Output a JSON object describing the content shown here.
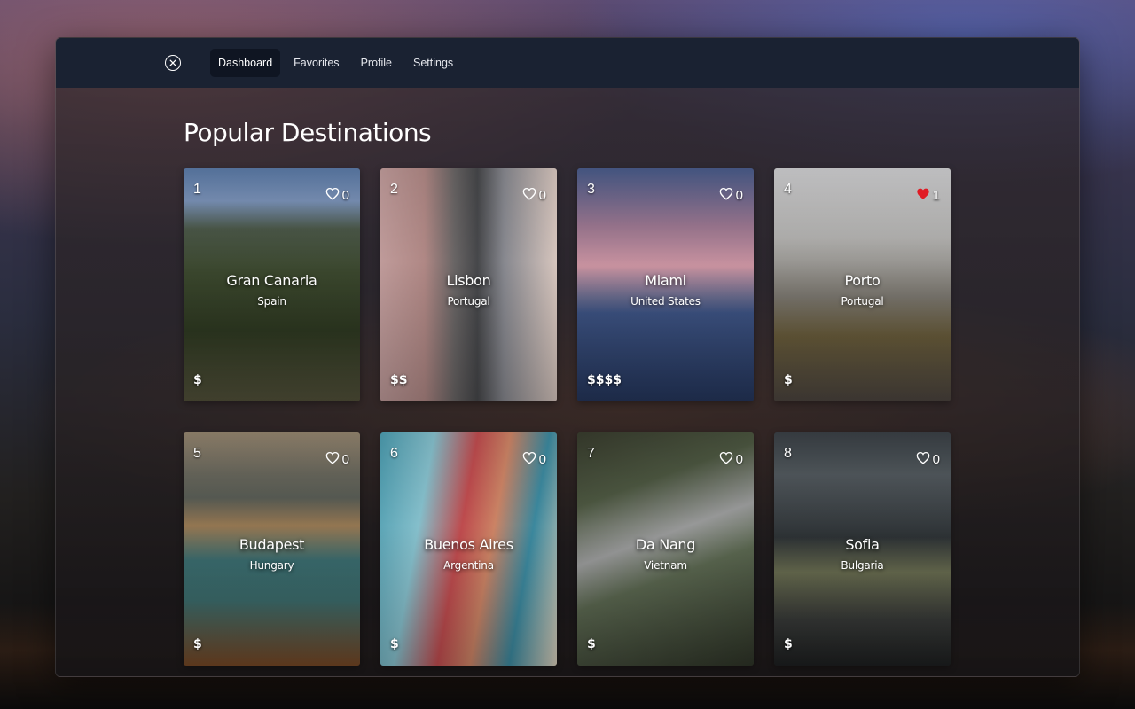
{
  "colors": {
    "topbar": "#1a2232",
    "active_tab": "#0f1522",
    "liked_heart": "#e01b24"
  },
  "nav": {
    "close_icon": "close-circle-icon",
    "tabs": [
      {
        "label": "Dashboard",
        "active": true
      },
      {
        "label": "Favorites",
        "active": false
      },
      {
        "label": "Profile",
        "active": false
      },
      {
        "label": "Settings",
        "active": false
      }
    ]
  },
  "main": {
    "title": "Popular Destinations",
    "cards": [
      {
        "rank": "1",
        "likes": "0",
        "liked": false,
        "city": "Gran Canaria",
        "country": "Spain",
        "price": "$",
        "theme": "forest"
      },
      {
        "rank": "2",
        "likes": "0",
        "liked": false,
        "city": "Lisbon",
        "country": "Portugal",
        "price": "$$",
        "theme": "street"
      },
      {
        "rank": "3",
        "likes": "0",
        "liked": false,
        "city": "Miami",
        "country": "United States",
        "price": "$$$$",
        "theme": "bay"
      },
      {
        "rank": "4",
        "likes": "1",
        "liked": true,
        "city": "Porto",
        "country": "Portugal",
        "price": "$",
        "theme": "church"
      },
      {
        "rank": "5",
        "likes": "0",
        "liked": false,
        "city": "Budapest",
        "country": "Hungary",
        "price": "$",
        "theme": "river"
      },
      {
        "rank": "6",
        "likes": "0",
        "liked": false,
        "city": "Buenos Aires",
        "country": "Argentina",
        "price": "$",
        "theme": "colorful"
      },
      {
        "rank": "7",
        "likes": "0",
        "liked": false,
        "city": "Da Nang",
        "country": "Vietnam",
        "price": "$",
        "theme": "bridge"
      },
      {
        "rank": "8",
        "likes": "0",
        "liked": false,
        "city": "Sofia",
        "country": "Bulgaria",
        "price": "$",
        "theme": "cathedral"
      }
    ]
  }
}
